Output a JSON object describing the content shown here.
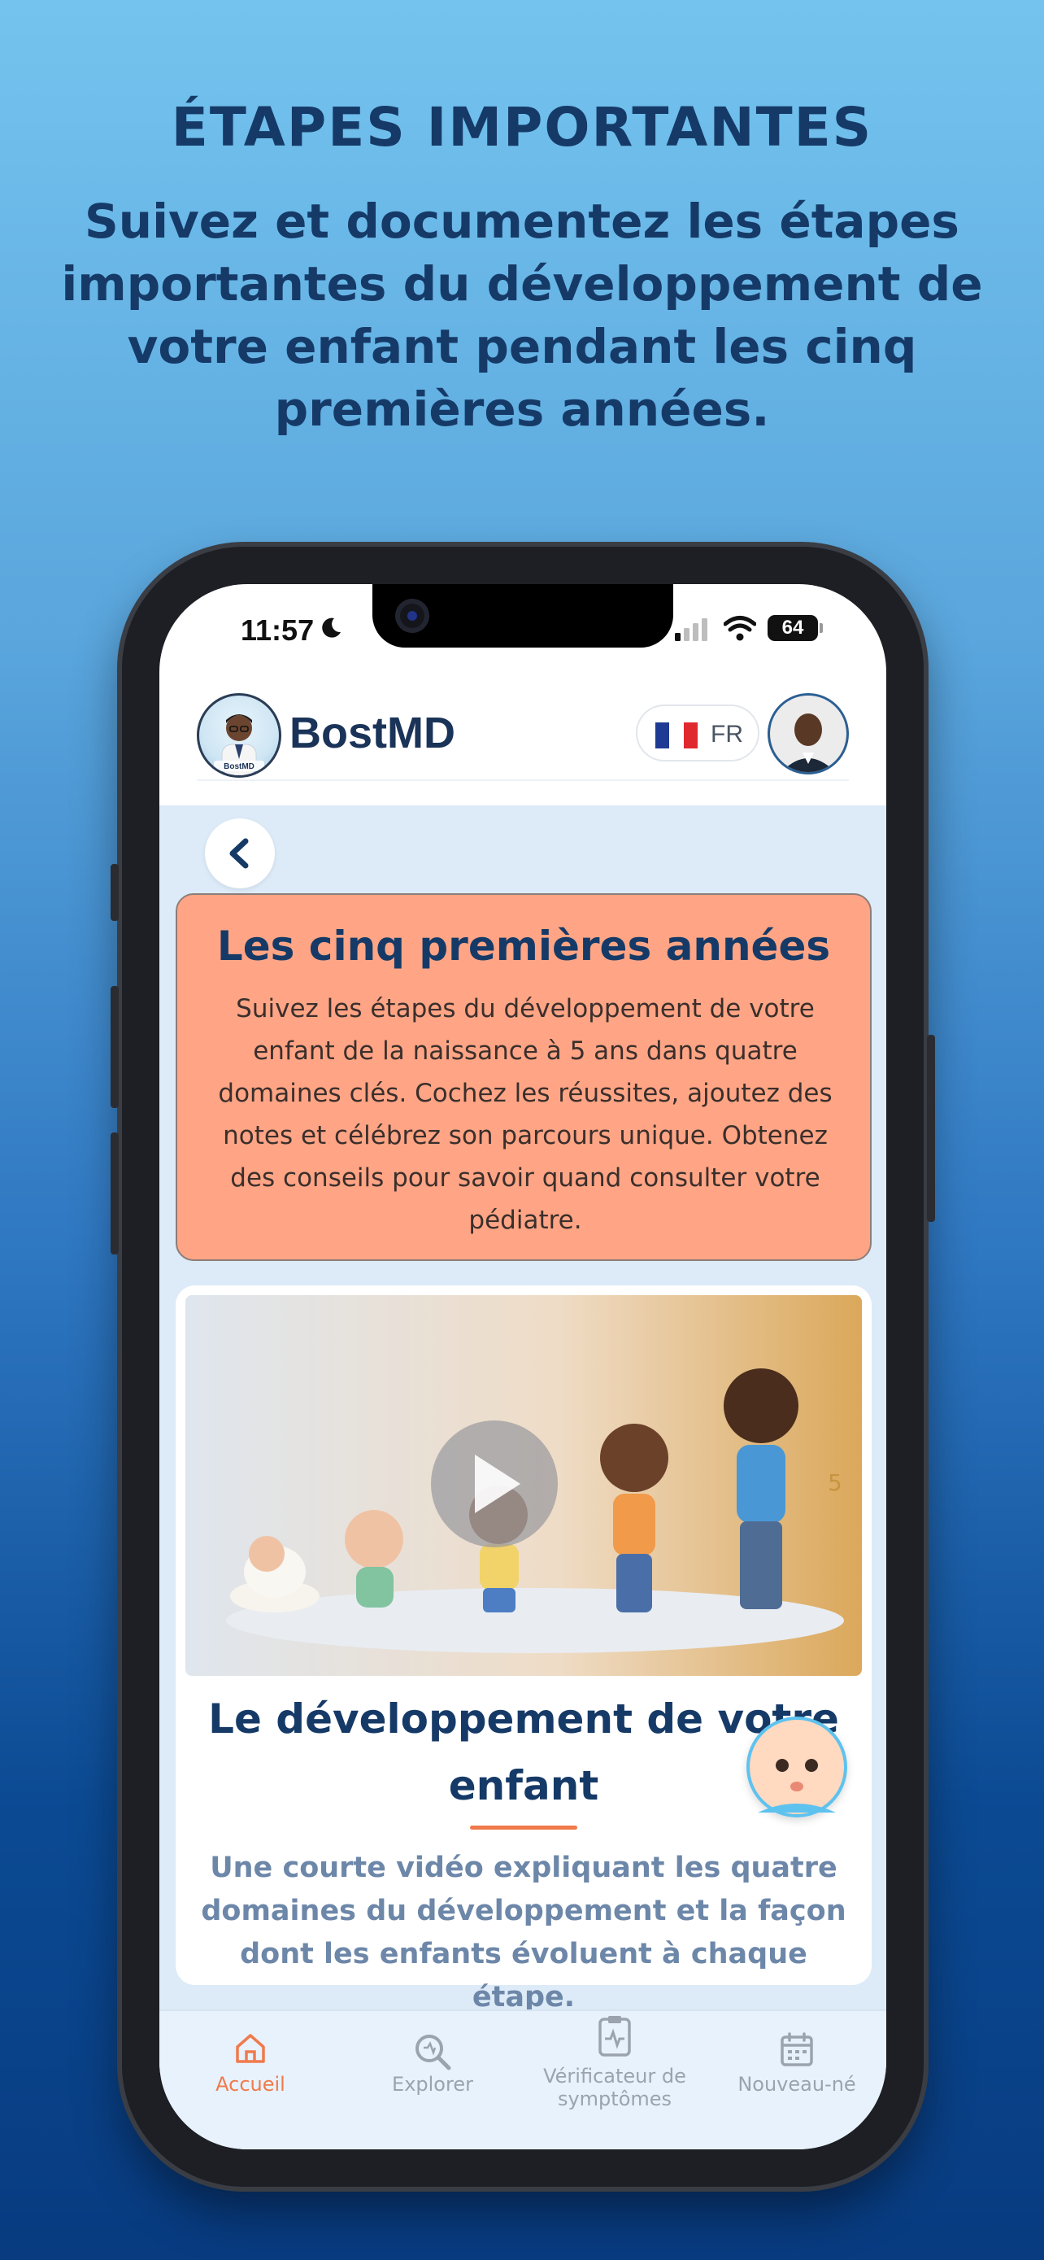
{
  "promo": {
    "heading": "ÉTAPES IMPORTANTES",
    "subheading": "Suivez et documentez les étapes importantes du développement de votre enfant pendant les cinq premières années."
  },
  "status_bar": {
    "time": "11:57",
    "battery": "64",
    "icons": [
      "moon-icon",
      "signal-icon",
      "wifi-icon",
      "battery-icon"
    ]
  },
  "header": {
    "brand": "BostMD",
    "logo_caption": "BostMD",
    "language": "FR"
  },
  "intro_card": {
    "title": "Les cinq premières années",
    "text": "Suivez les étapes du développement de votre enfant de la naissance à 5 ans dans quatre domaines clés. Cochez les réussites, ajoutez des notes et célébrez son parcours unique. Obtenez des conseils pour savoir quand consulter votre pédiatre."
  },
  "video_card": {
    "title": "Le développement de votre enfant",
    "description": "Une courte vidéo expliquant les quatre domaines du développement et la façon dont les enfants évoluent à chaque étape.",
    "thumbnail_number": "5"
  },
  "bottom_nav": {
    "items": [
      {
        "label": "Accueil",
        "icon": "home-icon",
        "active": true
      },
      {
        "label": "Explorer",
        "icon": "search-icon",
        "active": false
      },
      {
        "label": "Vérificateur de symptômes",
        "icon": "clipboard-icon",
        "active": false
      },
      {
        "label": "Nouveau-né",
        "icon": "calendar-icon",
        "active": false
      }
    ]
  },
  "colors": {
    "accent": "#f07a4c",
    "navy": "#163a67",
    "intro_card_bg": "#ffa585"
  }
}
